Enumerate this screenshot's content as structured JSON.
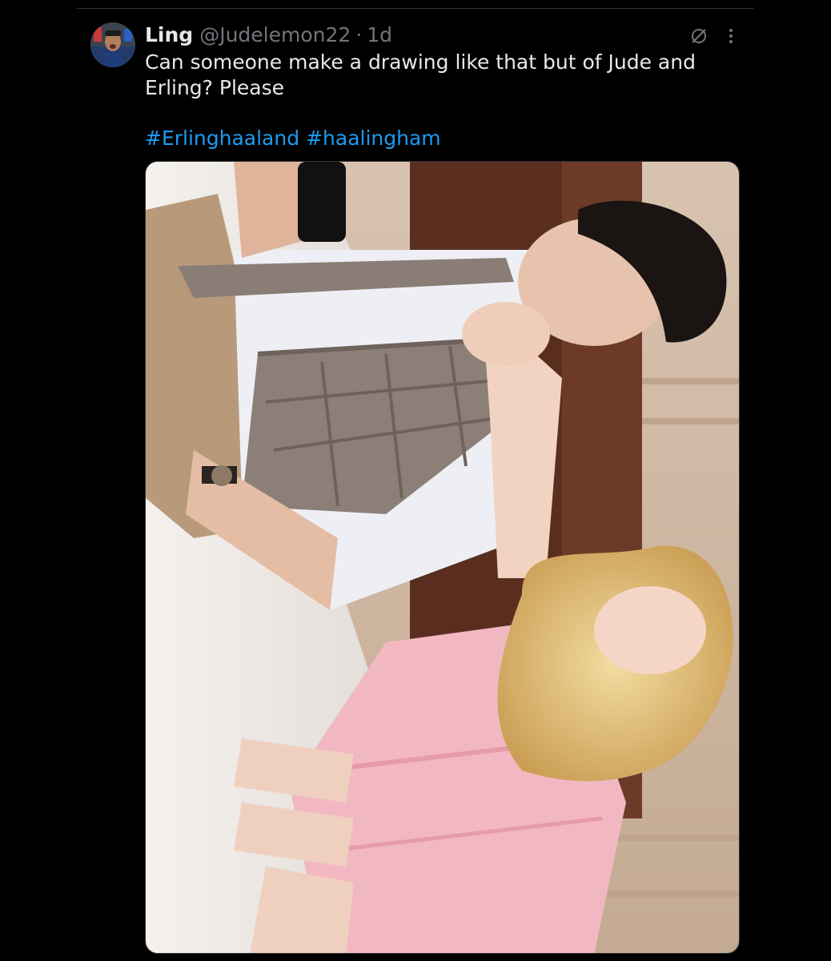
{
  "tweet": {
    "author": {
      "display_name": "Ling",
      "handle": "@Judelemon22",
      "separator": "·",
      "time": "1d"
    },
    "text": "Can someone make a drawing like that but of Jude and\nErling? Please",
    "hashtags": [
      "#Erlinghaaland",
      "#haalingham"
    ],
    "icons": {
      "grok": "grok-slash-circle-icon",
      "more": "more-vertical-icon"
    },
    "media": {
      "kind": "photo"
    }
  },
  "colors": {
    "background": "#000000",
    "text_primary": "#e7e9ea",
    "text_secondary": "#71767b",
    "link": "#1d9bf0",
    "divider": "#2f3336"
  }
}
